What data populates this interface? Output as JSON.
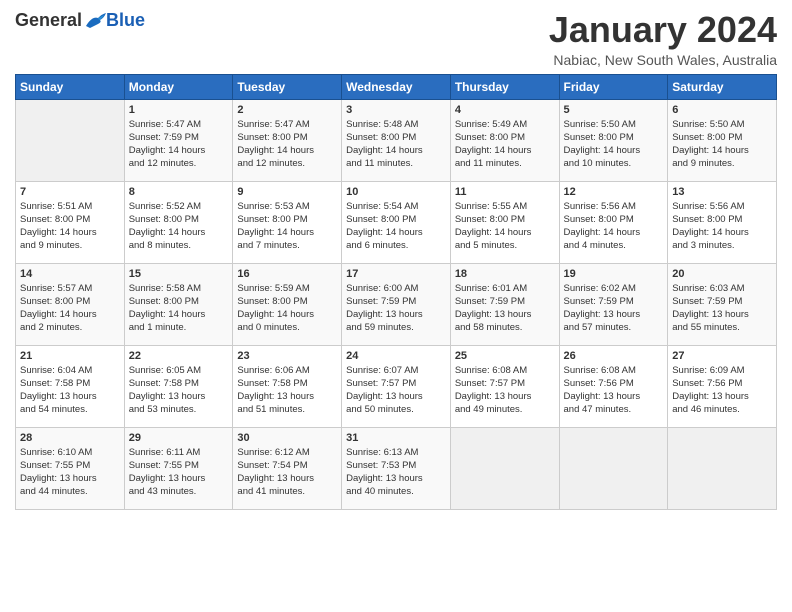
{
  "logo": {
    "general": "General",
    "blue": "Blue"
  },
  "title": "January 2024",
  "location": "Nabiac, New South Wales, Australia",
  "days_of_week": [
    "Sunday",
    "Monday",
    "Tuesday",
    "Wednesday",
    "Thursday",
    "Friday",
    "Saturday"
  ],
  "weeks": [
    [
      {
        "day": "",
        "info": ""
      },
      {
        "day": "1",
        "info": "Sunrise: 5:47 AM\nSunset: 7:59 PM\nDaylight: 14 hours\nand 12 minutes."
      },
      {
        "day": "2",
        "info": "Sunrise: 5:47 AM\nSunset: 8:00 PM\nDaylight: 14 hours\nand 12 minutes."
      },
      {
        "day": "3",
        "info": "Sunrise: 5:48 AM\nSunset: 8:00 PM\nDaylight: 14 hours\nand 11 minutes."
      },
      {
        "day": "4",
        "info": "Sunrise: 5:49 AM\nSunset: 8:00 PM\nDaylight: 14 hours\nand 11 minutes."
      },
      {
        "day": "5",
        "info": "Sunrise: 5:50 AM\nSunset: 8:00 PM\nDaylight: 14 hours\nand 10 minutes."
      },
      {
        "day": "6",
        "info": "Sunrise: 5:50 AM\nSunset: 8:00 PM\nDaylight: 14 hours\nand 9 minutes."
      }
    ],
    [
      {
        "day": "7",
        "info": "Sunrise: 5:51 AM\nSunset: 8:00 PM\nDaylight: 14 hours\nand 9 minutes."
      },
      {
        "day": "8",
        "info": "Sunrise: 5:52 AM\nSunset: 8:00 PM\nDaylight: 14 hours\nand 8 minutes."
      },
      {
        "day": "9",
        "info": "Sunrise: 5:53 AM\nSunset: 8:00 PM\nDaylight: 14 hours\nand 7 minutes."
      },
      {
        "day": "10",
        "info": "Sunrise: 5:54 AM\nSunset: 8:00 PM\nDaylight: 14 hours\nand 6 minutes."
      },
      {
        "day": "11",
        "info": "Sunrise: 5:55 AM\nSunset: 8:00 PM\nDaylight: 14 hours\nand 5 minutes."
      },
      {
        "day": "12",
        "info": "Sunrise: 5:56 AM\nSunset: 8:00 PM\nDaylight: 14 hours\nand 4 minutes."
      },
      {
        "day": "13",
        "info": "Sunrise: 5:56 AM\nSunset: 8:00 PM\nDaylight: 14 hours\nand 3 minutes."
      }
    ],
    [
      {
        "day": "14",
        "info": "Sunrise: 5:57 AM\nSunset: 8:00 PM\nDaylight: 14 hours\nand 2 minutes."
      },
      {
        "day": "15",
        "info": "Sunrise: 5:58 AM\nSunset: 8:00 PM\nDaylight: 14 hours\nand 1 minute."
      },
      {
        "day": "16",
        "info": "Sunrise: 5:59 AM\nSunset: 8:00 PM\nDaylight: 14 hours\nand 0 minutes."
      },
      {
        "day": "17",
        "info": "Sunrise: 6:00 AM\nSunset: 7:59 PM\nDaylight: 13 hours\nand 59 minutes."
      },
      {
        "day": "18",
        "info": "Sunrise: 6:01 AM\nSunset: 7:59 PM\nDaylight: 13 hours\nand 58 minutes."
      },
      {
        "day": "19",
        "info": "Sunrise: 6:02 AM\nSunset: 7:59 PM\nDaylight: 13 hours\nand 57 minutes."
      },
      {
        "day": "20",
        "info": "Sunrise: 6:03 AM\nSunset: 7:59 PM\nDaylight: 13 hours\nand 55 minutes."
      }
    ],
    [
      {
        "day": "21",
        "info": "Sunrise: 6:04 AM\nSunset: 7:58 PM\nDaylight: 13 hours\nand 54 minutes."
      },
      {
        "day": "22",
        "info": "Sunrise: 6:05 AM\nSunset: 7:58 PM\nDaylight: 13 hours\nand 53 minutes."
      },
      {
        "day": "23",
        "info": "Sunrise: 6:06 AM\nSunset: 7:58 PM\nDaylight: 13 hours\nand 51 minutes."
      },
      {
        "day": "24",
        "info": "Sunrise: 6:07 AM\nSunset: 7:57 PM\nDaylight: 13 hours\nand 50 minutes."
      },
      {
        "day": "25",
        "info": "Sunrise: 6:08 AM\nSunset: 7:57 PM\nDaylight: 13 hours\nand 49 minutes."
      },
      {
        "day": "26",
        "info": "Sunrise: 6:08 AM\nSunset: 7:56 PM\nDaylight: 13 hours\nand 47 minutes."
      },
      {
        "day": "27",
        "info": "Sunrise: 6:09 AM\nSunset: 7:56 PM\nDaylight: 13 hours\nand 46 minutes."
      }
    ],
    [
      {
        "day": "28",
        "info": "Sunrise: 6:10 AM\nSunset: 7:55 PM\nDaylight: 13 hours\nand 44 minutes."
      },
      {
        "day": "29",
        "info": "Sunrise: 6:11 AM\nSunset: 7:55 PM\nDaylight: 13 hours\nand 43 minutes."
      },
      {
        "day": "30",
        "info": "Sunrise: 6:12 AM\nSunset: 7:54 PM\nDaylight: 13 hours\nand 41 minutes."
      },
      {
        "day": "31",
        "info": "Sunrise: 6:13 AM\nSunset: 7:53 PM\nDaylight: 13 hours\nand 40 minutes."
      },
      {
        "day": "",
        "info": ""
      },
      {
        "day": "",
        "info": ""
      },
      {
        "day": "",
        "info": ""
      }
    ]
  ]
}
